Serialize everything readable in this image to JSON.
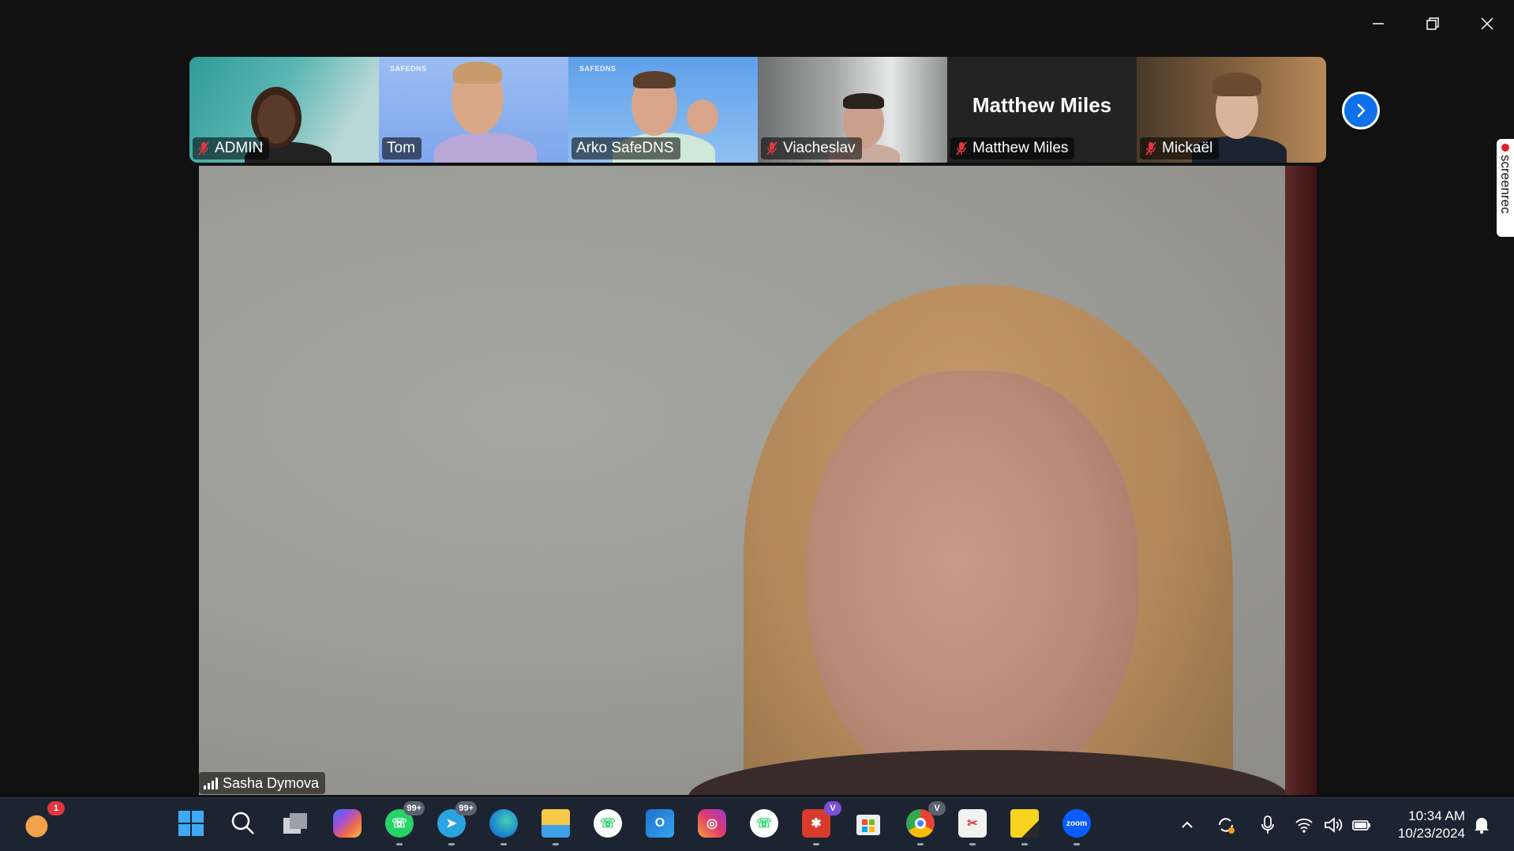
{
  "window": {
    "controls": [
      "minimize",
      "restore",
      "close"
    ]
  },
  "gallery": {
    "participants": [
      {
        "name": "ADMIN",
        "muted": true
      },
      {
        "name": "Tom",
        "muted": false,
        "brand": "SAFEDNS"
      },
      {
        "name": "Arko SafeDNS",
        "muted": false,
        "brand": "SAFEDNS"
      },
      {
        "name": "Viacheslav",
        "muted": true
      },
      {
        "name": "Matthew Miles",
        "muted": true,
        "display_name": "Matthew Miles"
      },
      {
        "name": "Mickaël",
        "muted": true
      }
    ],
    "next_icon": "chevron-right-icon"
  },
  "screenrec": {
    "label": "screenrec"
  },
  "main": {
    "speaker_name": "Sasha Dymova"
  },
  "taskbar": {
    "weather_badge": "1",
    "whatsapp_badge": "99+",
    "telegram_badge": "99+",
    "app_v_badge": "V",
    "chrome_badge": "V",
    "zoom_label": "zoom",
    "icons": [
      "weather-icon",
      "start-icon",
      "search-icon",
      "task-view-icon",
      "copilot-icon",
      "whatsapp-icon",
      "telegram-icon",
      "edge-icon",
      "file-explorer-icon",
      "whatsapp-alt-icon",
      "outlook-icon",
      "instagram-icon",
      "whatsapp-desktop-icon",
      "app-red-icon",
      "microsoft-store-icon",
      "chrome-icon",
      "snipping-tool-icon",
      "sticky-notes-icon",
      "zoom-icon"
    ]
  },
  "tray": {
    "time": "10:34 AM",
    "date": "10/23/2024"
  },
  "colors": {
    "accent": "#0e71eb",
    "taskbar": "#1c2431",
    "muted": "#e0383e"
  }
}
